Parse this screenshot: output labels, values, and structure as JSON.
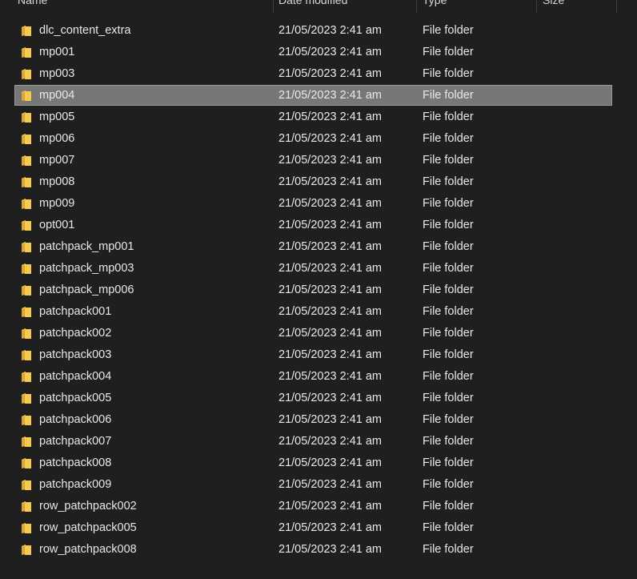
{
  "columns": {
    "name": "Name",
    "date": "Date modified",
    "type": "Type",
    "size": "Size"
  },
  "colors": {
    "background": "#1f1f1f",
    "selected_row": "#777777",
    "folder_front": "#f6c94f",
    "folder_back": "#d9a737"
  },
  "icons": {
    "folder": "folder-icon"
  },
  "selected_index": 3,
  "rows": [
    {
      "name": "dlc_content_extra",
      "date": "21/05/2023 2:41 am",
      "type": "File folder"
    },
    {
      "name": "mp001",
      "date": "21/05/2023 2:41 am",
      "type": "File folder"
    },
    {
      "name": "mp003",
      "date": "21/05/2023 2:41 am",
      "type": "File folder"
    },
    {
      "name": "mp004",
      "date": "21/05/2023 2:41 am",
      "type": "File folder"
    },
    {
      "name": "mp005",
      "date": "21/05/2023 2:41 am",
      "type": "File folder"
    },
    {
      "name": "mp006",
      "date": "21/05/2023 2:41 am",
      "type": "File folder"
    },
    {
      "name": "mp007",
      "date": "21/05/2023 2:41 am",
      "type": "File folder"
    },
    {
      "name": "mp008",
      "date": "21/05/2023 2:41 am",
      "type": "File folder"
    },
    {
      "name": "mp009",
      "date": "21/05/2023 2:41 am",
      "type": "File folder"
    },
    {
      "name": "opt001",
      "date": "21/05/2023 2:41 am",
      "type": "File folder"
    },
    {
      "name": "patchpack_mp001",
      "date": "21/05/2023 2:41 am",
      "type": "File folder"
    },
    {
      "name": "patchpack_mp003",
      "date": "21/05/2023 2:41 am",
      "type": "File folder"
    },
    {
      "name": "patchpack_mp006",
      "date": "21/05/2023 2:41 am",
      "type": "File folder"
    },
    {
      "name": "patchpack001",
      "date": "21/05/2023 2:41 am",
      "type": "File folder"
    },
    {
      "name": "patchpack002",
      "date": "21/05/2023 2:41 am",
      "type": "File folder"
    },
    {
      "name": "patchpack003",
      "date": "21/05/2023 2:41 am",
      "type": "File folder"
    },
    {
      "name": "patchpack004",
      "date": "21/05/2023 2:41 am",
      "type": "File folder"
    },
    {
      "name": "patchpack005",
      "date": "21/05/2023 2:41 am",
      "type": "File folder"
    },
    {
      "name": "patchpack006",
      "date": "21/05/2023 2:41 am",
      "type": "File folder"
    },
    {
      "name": "patchpack007",
      "date": "21/05/2023 2:41 am",
      "type": "File folder"
    },
    {
      "name": "patchpack008",
      "date": "21/05/2023 2:41 am",
      "type": "File folder"
    },
    {
      "name": "patchpack009",
      "date": "21/05/2023 2:41 am",
      "type": "File folder"
    },
    {
      "name": "row_patchpack002",
      "date": "21/05/2023 2:41 am",
      "type": "File folder"
    },
    {
      "name": "row_patchpack005",
      "date": "21/05/2023 2:41 am",
      "type": "File folder"
    },
    {
      "name": "row_patchpack008",
      "date": "21/05/2023 2:41 am",
      "type": "File folder"
    }
  ]
}
